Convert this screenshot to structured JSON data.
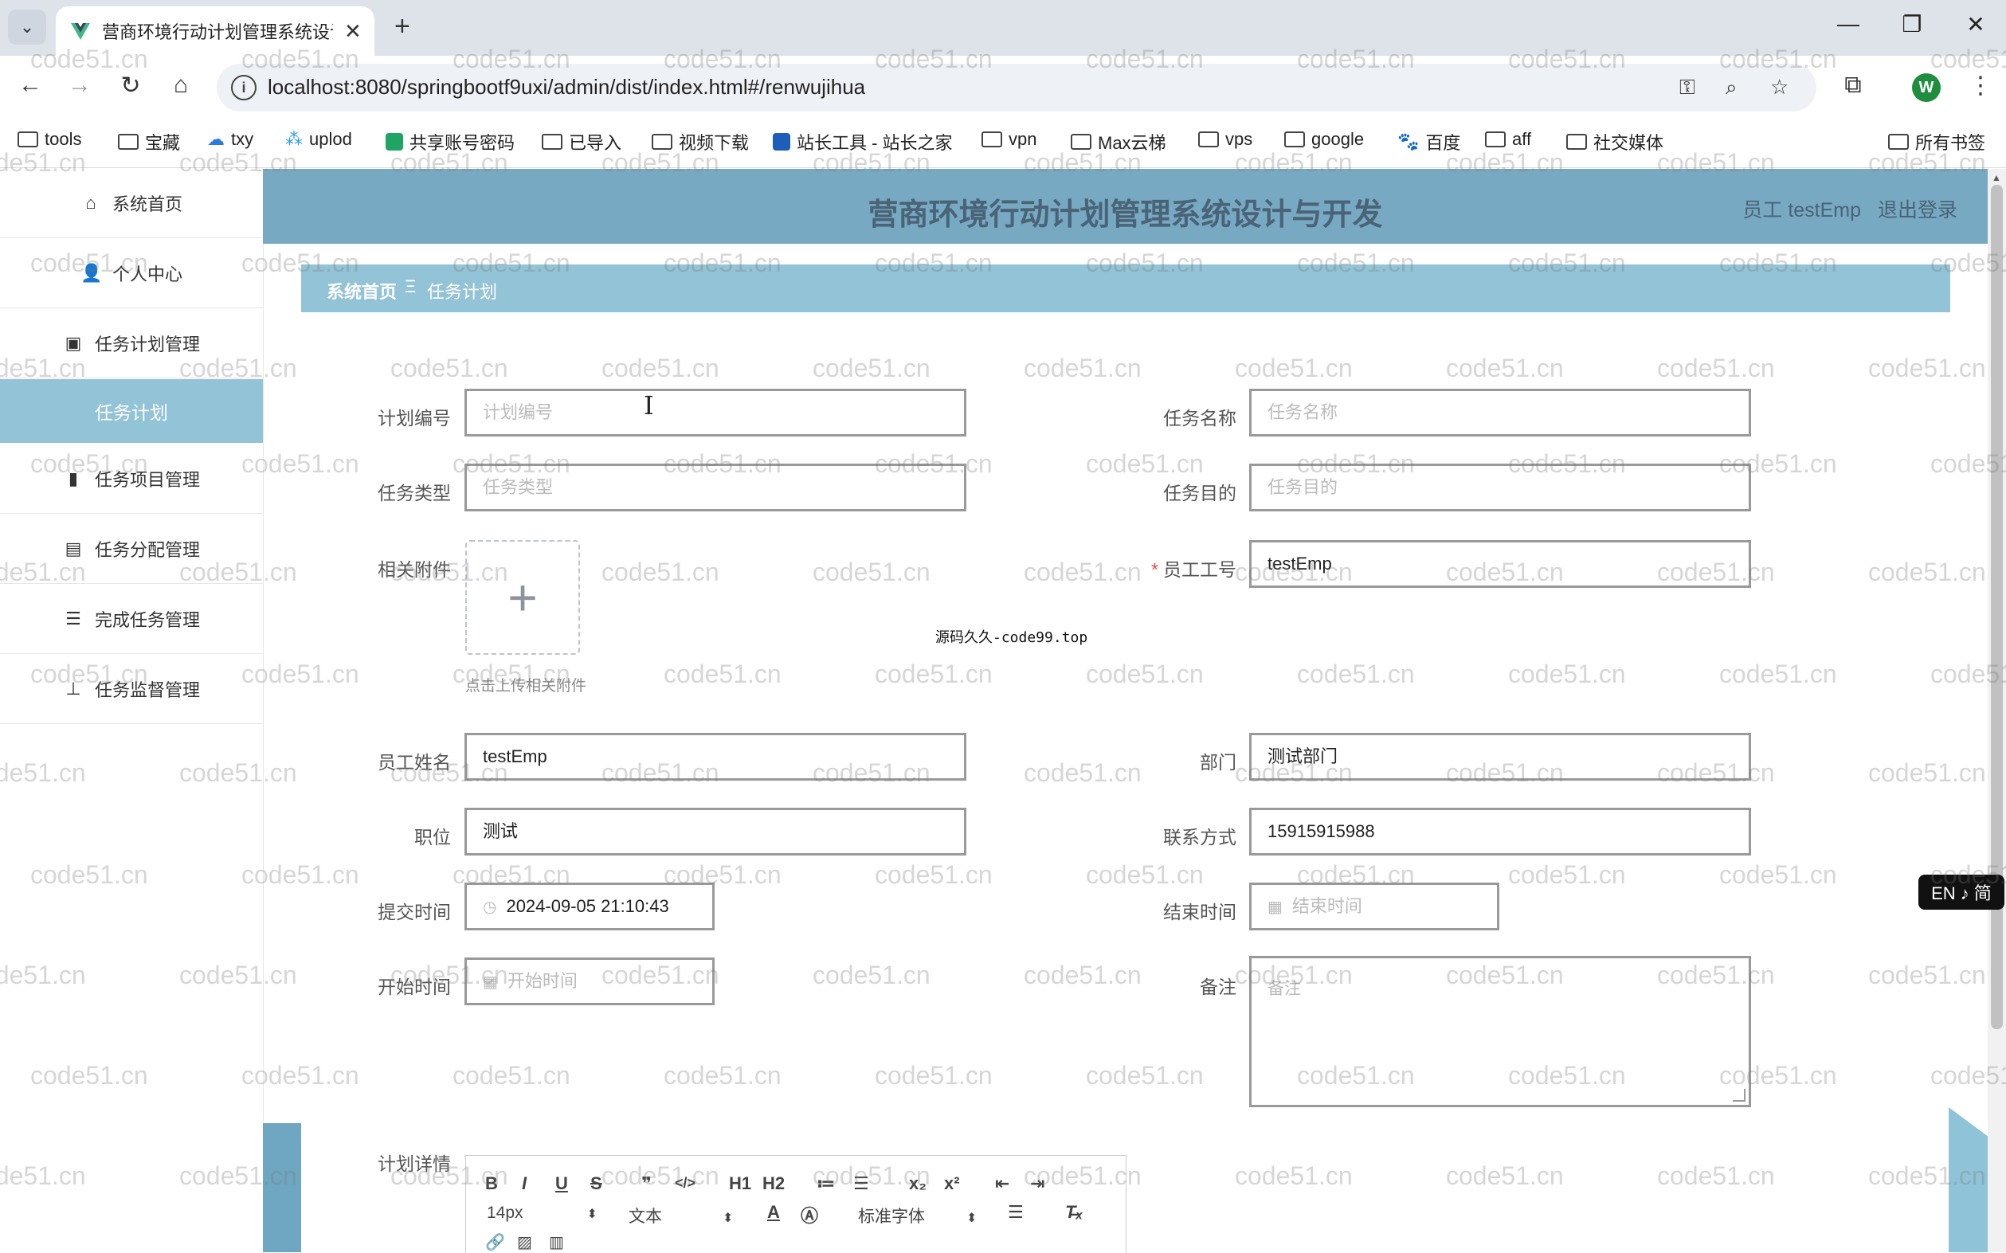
{
  "browser": {
    "tab_title": "营商环境行动计划管理系统设计",
    "url": "localhost:8080/springbootf9uxi/admin/dist/index.html#/renwujihua",
    "bookmarks": [
      "tools",
      "宝藏",
      "txy",
      "uplod",
      "共享账号密码",
      "已导入",
      "视频下载",
      "站长工具 - 站长之家",
      "vpn",
      "Max云梯",
      "vps",
      "google",
      "百度",
      "aff",
      "社交媒体"
    ],
    "all_bookmarks": "所有书签",
    "avatar_letter": "W"
  },
  "app": {
    "title": "营商环境行动计划管理系统设计与开发",
    "user_role": "员工 testEmp",
    "logout": "退出登录"
  },
  "sidebar": {
    "items": [
      {
        "label": "系统首页",
        "icon": "home-icon"
      },
      {
        "label": "个人中心",
        "icon": "user-icon"
      },
      {
        "label": "任务计划管理",
        "icon": "clipboard-icon"
      },
      {
        "label": "任务项目管理",
        "icon": "bar-chart-icon"
      },
      {
        "label": "任务分配管理",
        "icon": "library-icon"
      },
      {
        "label": "完成任务管理",
        "icon": "list-icon"
      },
      {
        "label": "任务监督管理",
        "icon": "stamp-icon"
      }
    ],
    "active_sub": "任务计划"
  },
  "breadcrumb": {
    "home": "系统首页",
    "separator": "Ξ",
    "current": "任务计划"
  },
  "form": {
    "plan_no": {
      "label": "计划编号",
      "placeholder": "计划编号"
    },
    "task_name": {
      "label": "任务名称",
      "placeholder": "任务名称"
    },
    "task_type": {
      "label": "任务类型",
      "placeholder": "任务类型"
    },
    "task_goal": {
      "label": "任务目的",
      "placeholder": "任务目的"
    },
    "attachment": {
      "label": "相关附件",
      "tip": "点击上传相关附件"
    },
    "emp_no": {
      "label": "员工工号",
      "value": "testEmp",
      "required_mark": "*"
    },
    "emp_name": {
      "label": "员工姓名",
      "value": "testEmp"
    },
    "dept": {
      "label": "部门",
      "value": "测试部门"
    },
    "position": {
      "label": "职位",
      "value": "测试"
    },
    "contact": {
      "label": "联系方式",
      "value": "15915915988"
    },
    "submit_time": {
      "label": "提交时间",
      "value": "2024-09-05 21:10:43"
    },
    "end_time": {
      "label": "结束时间",
      "placeholder": "结束时间"
    },
    "start_time": {
      "label": "开始时间",
      "placeholder": "开始时间"
    },
    "remark": {
      "label": "备注",
      "placeholder": "备注"
    },
    "plan_detail": {
      "label": "计划详情"
    }
  },
  "editor": {
    "font_size": "14px",
    "paragraph": "文本",
    "font_family": "标准字体",
    "buttons": [
      "B",
      "I",
      "U",
      "S",
      "❞",
      "</>",
      "H1",
      "H2",
      "≔",
      "☰",
      "x₂",
      "x²",
      "⇤",
      "⇥"
    ]
  },
  "center_note": "源码久久-code99.top",
  "watermark": "code51.cn",
  "ime": "EN ♪ 简"
}
